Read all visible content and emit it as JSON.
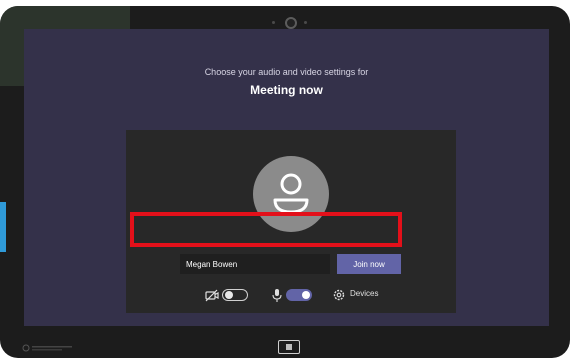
{
  "meeting": {
    "prompt": "Choose your audio and video settings for",
    "title": "Meeting now"
  },
  "join_form": {
    "name_value": "Megan Bowen",
    "join_label": "Join now"
  },
  "controls": {
    "camera_on": false,
    "mic_on": true,
    "devices_label": "Devices"
  },
  "colors": {
    "accent": "#6264a7",
    "highlight": "#e3101a",
    "screen_bg": "#34314a",
    "panel_bg": "#282828"
  },
  "icons": [
    "camera-off-icon",
    "microphone-icon",
    "gear-icon",
    "person-icon",
    "home-icon",
    "front-camera-icon"
  ]
}
